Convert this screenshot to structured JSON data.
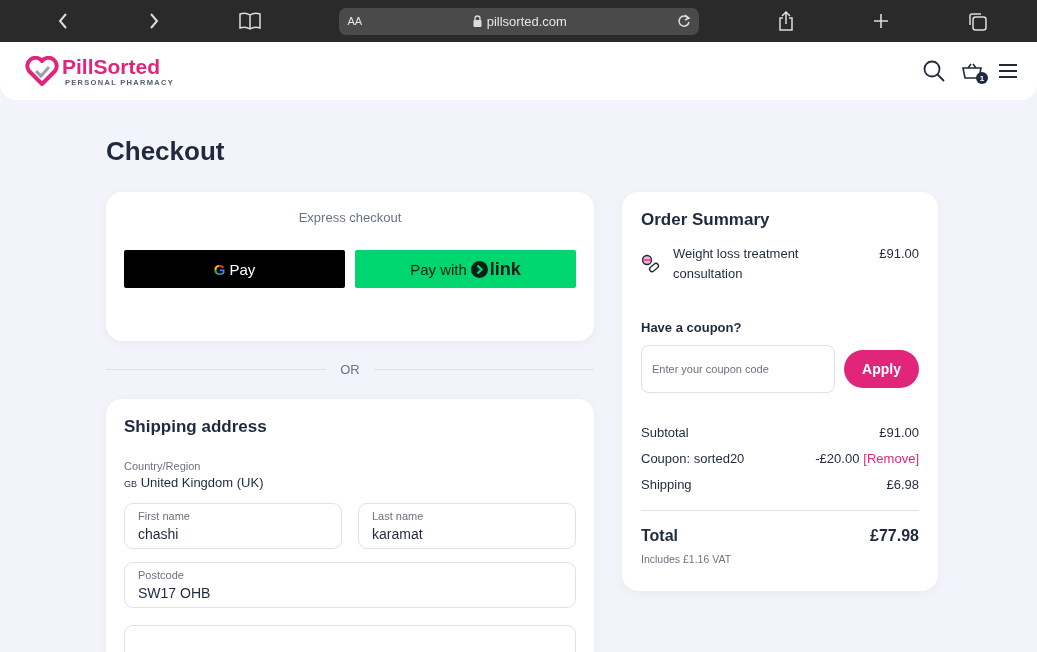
{
  "browser": {
    "reader_label": "AA",
    "url": "pillsorted.com"
  },
  "header": {
    "logo": {
      "name": "PillSorted",
      "tagline": "PERSONAL PHARMACY"
    },
    "cart_count": "1"
  },
  "page_title": "Checkout",
  "express_checkout": {
    "title": "Express checkout",
    "buttons": [
      {
        "kind": "gpay",
        "logo_text": "G",
        "label": "Pay"
      },
      {
        "kind": "link",
        "label": "Pay with",
        "brand": "link"
      }
    ]
  },
  "divider": "OR",
  "shipping": {
    "title": "Shipping address",
    "country_label": "Country/Region",
    "country_code": "GB",
    "country": "United Kingdom (UK)",
    "field_rows": [
      [
        {
          "label": "First name",
          "value": "chashi"
        },
        {
          "label": "Last name",
          "value": "karamat"
        }
      ],
      [
        {
          "label": "Postcode",
          "value": "SW17 OHB"
        }
      ]
    ]
  },
  "order_summary": {
    "title": "Order Summary",
    "items": [
      {
        "name": "Weight loss treatment consultation",
        "price": "£91.00"
      }
    ],
    "coupon": {
      "label": "Have a coupon?",
      "placeholder": "Enter your coupon code",
      "button": "Apply"
    },
    "totals": [
      {
        "label": "Subtotal",
        "value": "£91.00"
      },
      {
        "label": "Coupon: sorted20",
        "value": "-£20.00",
        "action": "[Remove]"
      },
      {
        "label": "Shipping",
        "value": "£6.98"
      }
    ],
    "total": {
      "label": "Total",
      "value": "£77.98",
      "note": "Includes £1.16 VAT"
    }
  }
}
